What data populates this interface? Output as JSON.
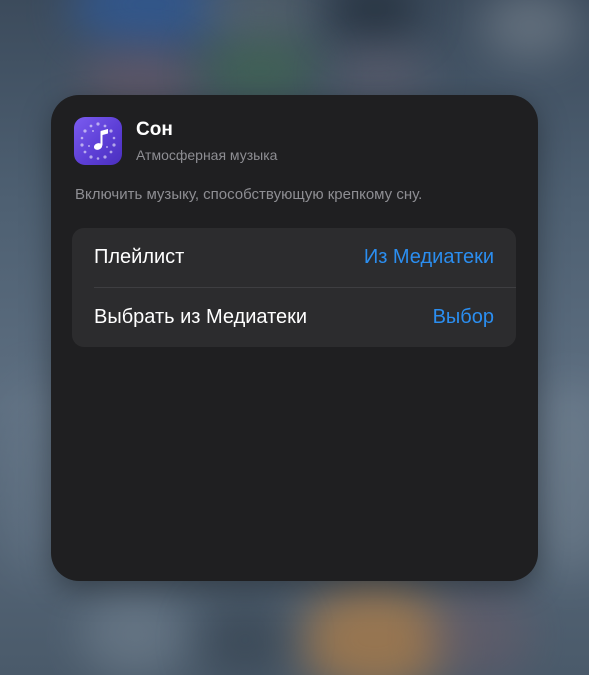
{
  "shortcut": {
    "title": "Сон",
    "subtitle": "Атмосферная музыка",
    "description": "Включить музыку, способствующую крепкому сну.",
    "icon": "music-note-icon",
    "icon_color": "#6b4de6"
  },
  "options": [
    {
      "label": "Плейлист",
      "value": "Из Медиатеки"
    },
    {
      "label": "Выбрать из Медиатеки",
      "value": "Выбор"
    }
  ],
  "colors": {
    "card_background": "#1f1f21",
    "row_background": "#2c2c2e",
    "accent": "#2b8ef0",
    "secondary_text": "#8e8e93"
  }
}
